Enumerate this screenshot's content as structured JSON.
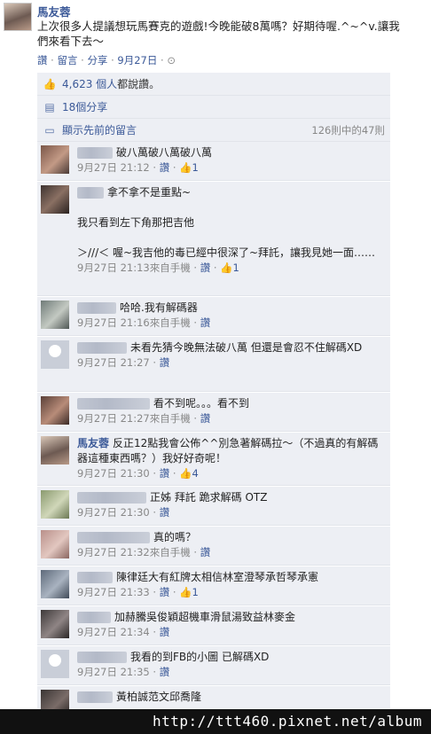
{
  "post": {
    "author": "馬友蓉",
    "text": "上次很多人提議想玩馬賽克的遊戲!今晚能破8萬嗎？好期待喔.^~^v.讓我們來看下去～",
    "actions": {
      "like": "讚",
      "comment": "留言",
      "share": "分享",
      "time": "9月27日",
      "sep": "·"
    }
  },
  "ufi": {
    "likes_count": "4,623 個人",
    "likes_suffix": "都說讚。",
    "shares": "18個分享",
    "prev_comments": "顯示先前的留言",
    "counter": "126則中的47則"
  },
  "comments": [
    {
      "text": "破八萬破八萬破八萬",
      "time": "9月27日 21:12",
      "like": "讚",
      "likes": "1",
      "mobile": ""
    },
    {
      "text": "拿不拿不是重點~",
      "text2": "我只看到左下角那把吉他",
      "text3": "＞///＜ 喔~我吉他的毒已經中很深了~拜託，讓我見她一面……",
      "time": "9月27日 21:13",
      "mobile": "來自手機",
      "like": "讚",
      "likes": "1"
    },
    {
      "text": "哈哈.我有解碼器",
      "time": "9月27日 21:16",
      "mobile": "來自手機",
      "like": "讚",
      "likes": ""
    },
    {
      "text": "未看先猜今晚無法破八萬 但還是會忍不住解碼XD",
      "time": "9月27日 21:27",
      "mobile": "",
      "like": "讚",
      "likes": ""
    },
    {
      "text": "看不到呢。。。看不到",
      "time": "9月27日 21:27",
      "mobile": "來自手機",
      "like": "讚",
      "likes": ""
    },
    {
      "author": "馬友蓉",
      "text": "反正12點我會公佈^^別急著解碼拉～（不過真的有解碼器這種東西嗎？）我好好奇呢！",
      "time": "9月27日 21:30",
      "mobile": "",
      "like": "讚",
      "likes": "4"
    },
    {
      "text": "正姊 拜託 跪求解碼 OTZ",
      "time": "9月27日 21:30",
      "mobile": "",
      "like": "讚",
      "likes": ""
    },
    {
      "text": "真的嗎？",
      "time": "9月27日 21:32",
      "mobile": "來自手機",
      "like": "讚",
      "likes": ""
    },
    {
      "text": "陳律廷大有紅牌太相信林室澄琴承哲琴承憲",
      "time": "9月27日 21:33",
      "mobile": "",
      "like": "讚",
      "likes": "1"
    },
    {
      "text": "加赫騰吳俊穎超機車滑鼠湯致益林麥金",
      "time": "9月27日 21:34",
      "mobile": "",
      "like": "讚",
      "likes": ""
    },
    {
      "text": "我看的到FB的小圖 已解碼XD",
      "time": "9月27日 21:35",
      "mobile": "",
      "like": "讚",
      "likes": ""
    },
    {
      "text": "黃柏誠范文邱喬隆",
      "time": "",
      "mobile": "",
      "like": "",
      "likes": ""
    }
  ],
  "watermark": "http://ttt460.pixnet.net/album",
  "colors": {
    "link": "#3b5998",
    "ufi_bg": "#edeff4",
    "meta": "#888888"
  },
  "icons": [
    "thumbs-up-icon",
    "share-icon",
    "comment-bubble-icon",
    "globe-icon"
  ]
}
